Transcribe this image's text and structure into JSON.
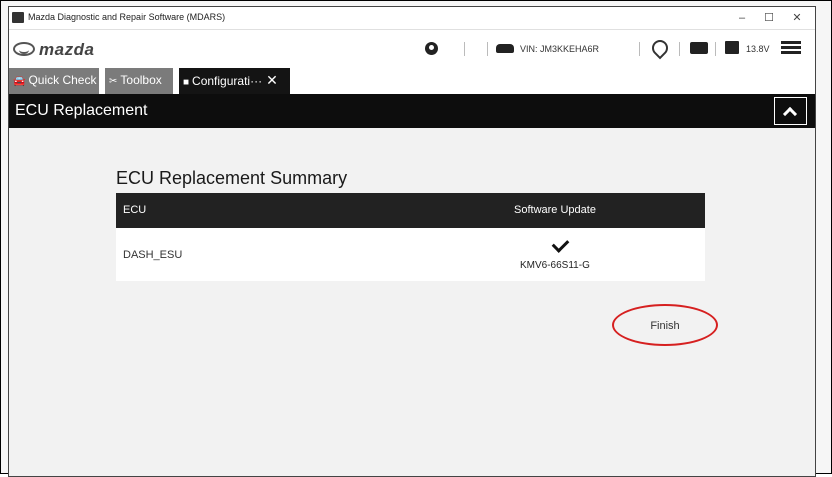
{
  "window": {
    "title": "Mazda Diagnostic and Repair Software (MDARS)",
    "minimize_glyph": "–",
    "maximize_glyph": "☐",
    "close_glyph": "✕"
  },
  "brand": {
    "logo_text": "mazda"
  },
  "status": {
    "vin": "VIN: JM3KKEHA6R",
    "voltage": "13.8V"
  },
  "tabs": [
    {
      "label": "Quick Check",
      "icon": "car-check-icon",
      "active": false
    },
    {
      "label": "Toolbox",
      "icon": "tools-icon",
      "active": false
    },
    {
      "label": "Configurati···",
      "icon": "chip-icon",
      "active": true,
      "close": "✕"
    }
  ],
  "header": {
    "title": "ECU Replacement"
  },
  "summary": {
    "title": "ECU Replacement Summary",
    "columns": [
      "ECU",
      "Software Update"
    ],
    "rows": [
      {
        "ecu": "DASH_ESU",
        "status_icon": "check-icon",
        "software": "KMV6-66S11-G"
      }
    ]
  },
  "actions": {
    "finish_label": "Finish"
  },
  "colors": {
    "header_bg": "#0d0d0d",
    "tab_inactive": "#7b7b7b",
    "tab_active": "#141414",
    "highlight_circle": "#d62020"
  }
}
